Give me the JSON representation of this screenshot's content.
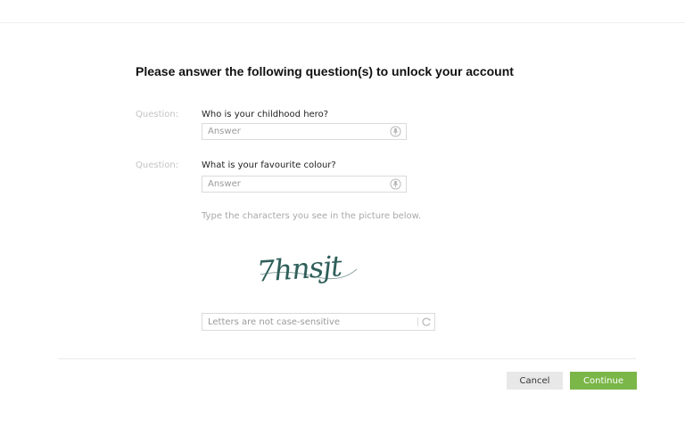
{
  "page": {
    "title": "Please answer the following question(s) to unlock your account"
  },
  "questions": [
    {
      "label": "Question:",
      "text": "Who is your childhood hero?",
      "answer_value": "",
      "answer_placeholder": "Answer",
      "icon": "microphone-icon"
    },
    {
      "label": "Question:",
      "text": "What is your favourite colour?",
      "answer_value": "",
      "answer_placeholder": "Answer",
      "icon": "microphone-icon"
    }
  ],
  "captcha": {
    "hint": "Type the characters you see in the picture below.",
    "image_text": "7hnsjt",
    "input_value": "",
    "input_placeholder": "Letters are not case-sensitive",
    "refresh_icon": "refresh-icon"
  },
  "actions": {
    "cancel_label": "Cancel",
    "continue_label": "Continue"
  },
  "colors": {
    "continue_button": "#7ab648",
    "cancel_button": "#e8e8e8",
    "captcha_ink": "#2f5f5a",
    "question_label": "#c4c4c4"
  }
}
